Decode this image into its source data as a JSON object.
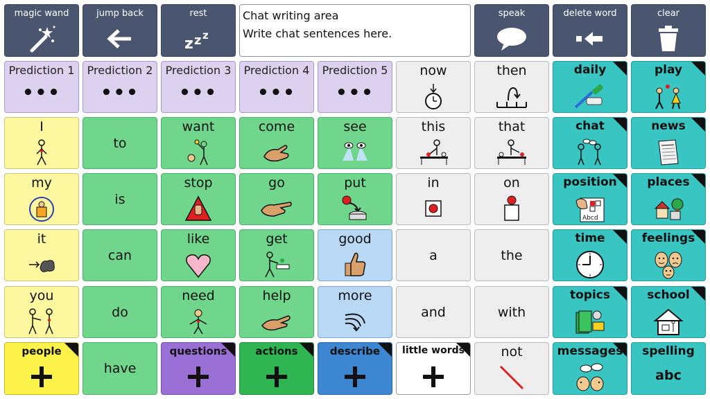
{
  "toolbar": {
    "magic_wand": "magic wand",
    "jump_back": "jump back",
    "rest": "rest",
    "speak": "speak",
    "delete_word": "delete word",
    "clear": "clear"
  },
  "chat": {
    "title": "Chat writing area",
    "placeholder": "Write chat sentences here."
  },
  "predictions": [
    "Prediction 1",
    "Prediction 2",
    "Prediction 3",
    "Prediction 4",
    "Prediction 5"
  ],
  "pred_dots": "•••",
  "words": {
    "now": "now",
    "then": "then",
    "I": "I",
    "to": "to",
    "want": "want",
    "come": "come",
    "see": "see",
    "this": "this",
    "that": "that",
    "my": "my",
    "is": "is",
    "stop": "stop",
    "go": "go",
    "put": "put",
    "in": "in",
    "on": "on",
    "it": "it",
    "can": "can",
    "like": "like",
    "get": "get",
    "good": "good",
    "a": "a",
    "the": "the",
    "you": "you",
    "do": "do",
    "need": "need",
    "help": "help",
    "more": "more",
    "and": "and",
    "with": "with",
    "have": "have",
    "not": "not"
  },
  "categories": {
    "daily": "daily",
    "play": "play",
    "chat": "chat",
    "news": "news",
    "position": "position",
    "places": "places",
    "time": "time",
    "feelings": "feelings",
    "topics": "topics",
    "school": "school",
    "messages": "messages",
    "spelling": "spelling",
    "people": "people",
    "questions": "questions",
    "actions": "actions",
    "describe": "describe",
    "little_words": "little words"
  },
  "spelling_abc": "abc",
  "position_card": "Abcd",
  "colors": {
    "toolbar": "#4a5670",
    "prediction": "#dcd1ee",
    "yellow": "#fdf8a0",
    "green": "#6fd68c",
    "blue": "#b9d8f5",
    "white": "#eeeeee",
    "teal": "#39c6c3"
  }
}
